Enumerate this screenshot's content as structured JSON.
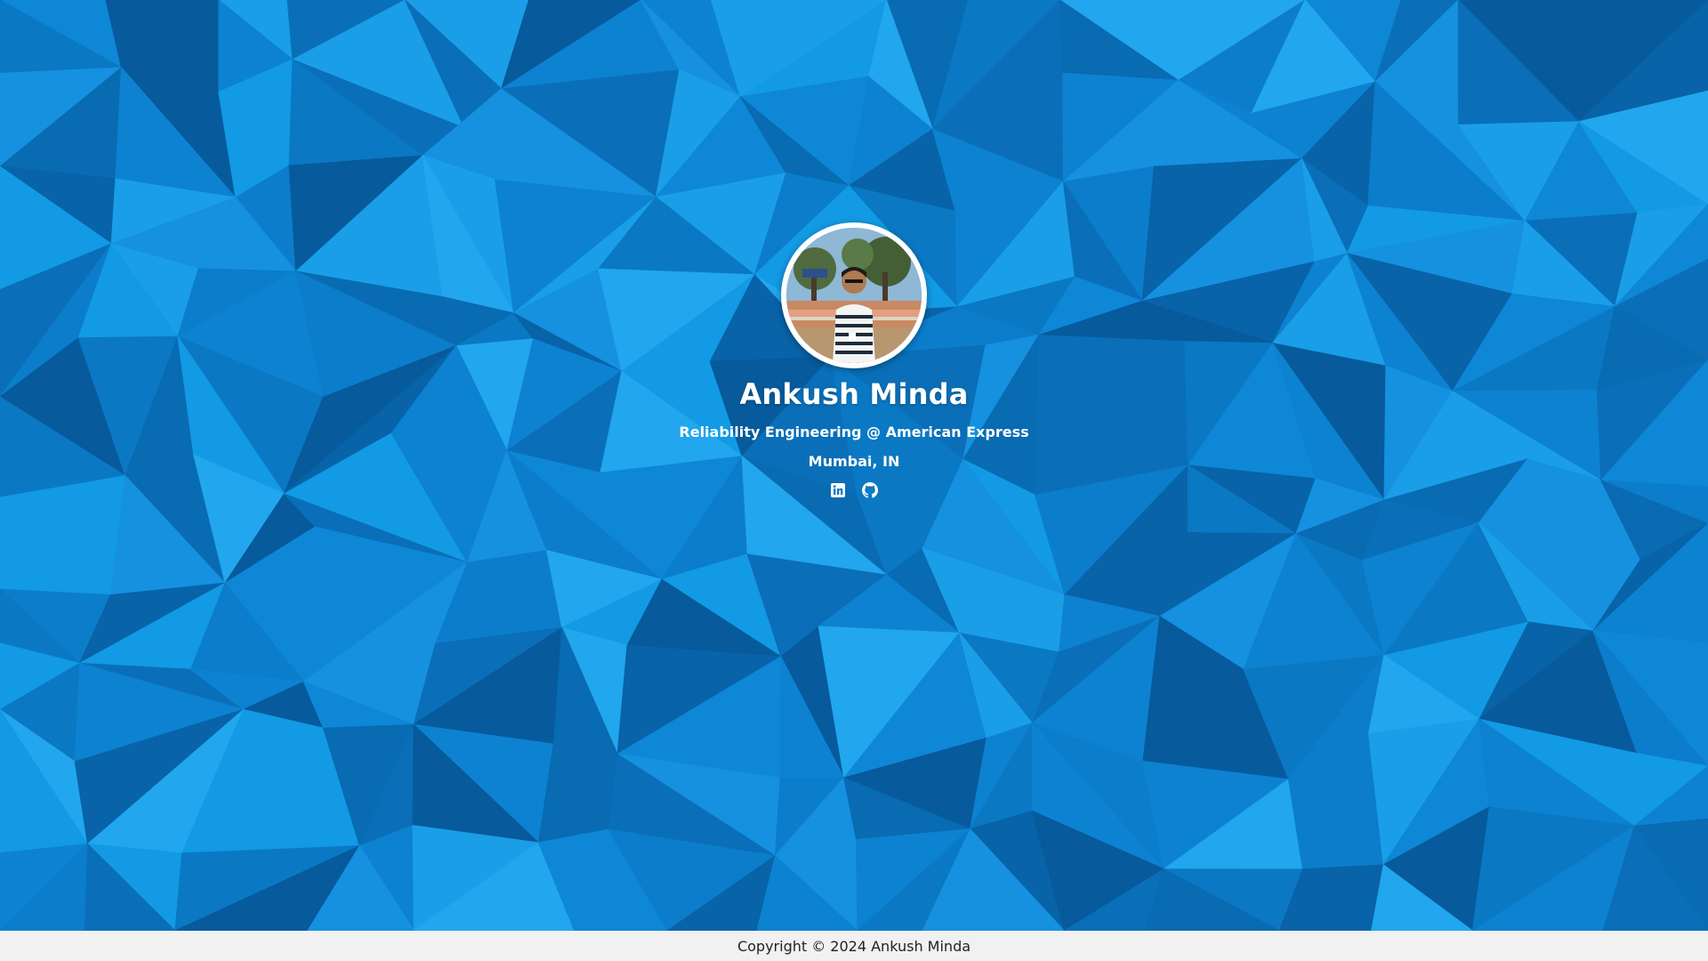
{
  "profile": {
    "name": "Ankush Minda",
    "role": "Reliability Engineering @ American Express",
    "location": "Mumbai, IN",
    "avatar_icon": "profile-photo"
  },
  "social": [
    {
      "name": "LinkedIn",
      "icon": "linkedin-icon"
    },
    {
      "name": "GitHub",
      "icon": "github-icon"
    }
  ],
  "footer": {
    "copyright": "Copyright © 2024 Ankush Minda"
  },
  "theme": {
    "background": "#0b7ac8",
    "text": "#ffffff",
    "footer_background": "#f1f1f1",
    "footer_text": "#222222"
  }
}
